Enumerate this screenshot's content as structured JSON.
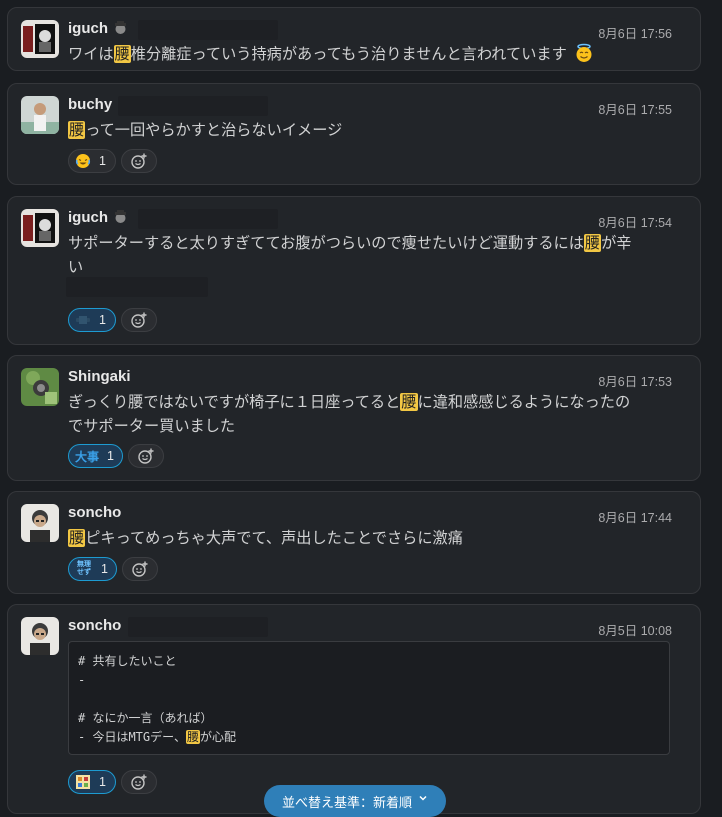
{
  "messages": [
    {
      "user": "iguch",
      "time": "8月6日 17:56",
      "text_parts": [
        "ワイは",
        "腰",
        "椎分離症っていう持病があってもう治りませんと言われています"
      ],
      "trailing_emoji": "innocent-face"
    },
    {
      "user": "buchy",
      "time": "8月6日 17:55",
      "text_parts": [
        "",
        "腰",
        "って一回やらかすと治らないイメージ"
      ],
      "reaction": {
        "emoji": "joy-face",
        "count": "1"
      }
    },
    {
      "user": "iguch",
      "time": "8月6日 17:54",
      "text_line1": [
        "サポーターすると太りすぎててお腹がつらいので痩せたいけど運動するには",
        "腰",
        "が辛"
      ],
      "text_line2": "い",
      "reaction": {
        "emoji": "custom-emoji",
        "count": "1"
      }
    },
    {
      "user": "Shingaki",
      "time": "8月6日 17:53",
      "text_line1": [
        "ぎっくり腰ではないですが椅子に１日座ってると",
        "腰",
        "に違和感感じるようになったの"
      ],
      "text_line2": "でサポーター買いました",
      "reaction": {
        "emoji": "大事",
        "count": "1"
      }
    },
    {
      "user": "soncho",
      "time": "8月6日 17:44",
      "text_parts": [
        "",
        "腰",
        "ピキってめっちゃ大声でて、声出したことでさらに激痛"
      ],
      "reaction": {
        "emoji_line1": "無理",
        "emoji_line2": "せず",
        "count": "1"
      }
    },
    {
      "user": "soncho",
      "time": "8月5日 10:08",
      "code_lines": [
        "# 共有したいこと",
        "-",
        "",
        "# なにか一言（あれば）"
      ],
      "code_last_parts": [
        "- 今日はMTGデー、",
        "腰",
        "が心配"
      ],
      "reaction": {
        "emoji": "custom-emoji",
        "count": "1"
      }
    }
  ],
  "sort_button_label": "並べ替え基準：新着順",
  "colors": {
    "highlight": "#f2c744",
    "background": "#1a1d21",
    "card": "#222529",
    "accent": "#1d9bd1"
  }
}
